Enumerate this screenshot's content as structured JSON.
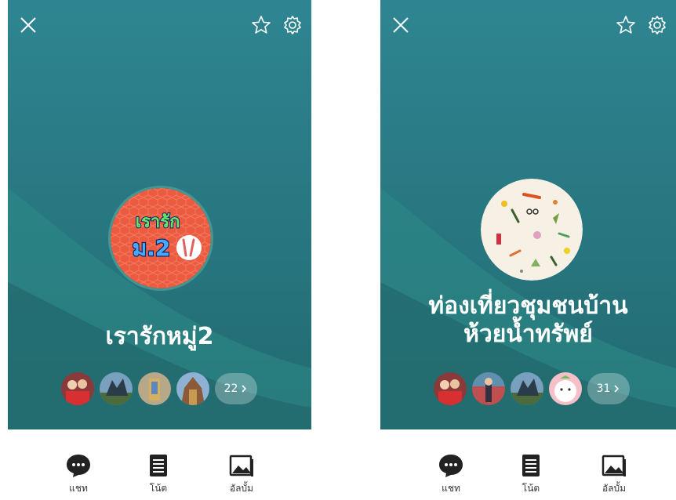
{
  "colors": {
    "panel_bg": "#2a7b82",
    "panel_dark": "#1f5f67",
    "text": "#ffffff",
    "tab_icon": "#222222"
  },
  "panels": [
    {
      "group_name": "เรารักหมู่2",
      "avatar_text_top": "เรารัก",
      "avatar_text_bottom": "ม.2",
      "member_count": "22",
      "icons": [
        "close-icon",
        "star-icon",
        "gear-icon"
      ]
    },
    {
      "group_name_line1": "ท่องเที่ยวชุมชนบ้าน",
      "group_name_line2": "ห้วยน้ำทรัพย์",
      "member_count": "31",
      "icons": [
        "close-icon",
        "star-icon",
        "gear-icon"
      ]
    }
  ],
  "tabs": [
    {
      "label": "แชท",
      "icon": "chat-icon"
    },
    {
      "label": "โน้ต",
      "icon": "note-icon"
    },
    {
      "label": "อัลบั้ม",
      "icon": "album-icon"
    }
  ]
}
